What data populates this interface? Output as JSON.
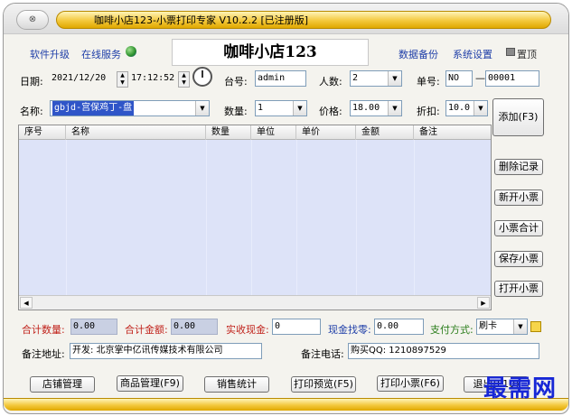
{
  "window": {
    "title": "咖啡小店123-小票打印专家 V10.2.2 [已注册版]",
    "sys_button": "⊗"
  },
  "top_links": {
    "upgrade": "软件升级",
    "online": "在线服务",
    "backup": "数据备份",
    "settings": "系统设置",
    "top": "置顶"
  },
  "shop_name": "咖啡小店123",
  "row1": {
    "date_label": "日期:",
    "date_value": "2021/12/20",
    "time_value": "17:12:52",
    "table_label": "台号:",
    "table_value": "admin",
    "people_label": "人数:",
    "people_value": "2",
    "order_label": "单号:",
    "order_prefix": "NO",
    "order_sep": "—",
    "order_value": "00001"
  },
  "row2": {
    "name_label": "名称:",
    "name_value": "gbjd-宫保鸡丁-盘",
    "qty_label": "数量:",
    "qty_value": "1",
    "price_label": "价格:",
    "price_value": "18.00",
    "discount_label": "折扣:",
    "discount_value": "10.0"
  },
  "table": {
    "columns": [
      "序号",
      "名称",
      "数量",
      "单位",
      "单价",
      "金额",
      "备注"
    ],
    "rows": []
  },
  "side_buttons": {
    "add": "添加(F3)",
    "delete": "删除记录",
    "new": "新开小票",
    "total": "小票合计",
    "save": "保存小票",
    "open": "打开小票"
  },
  "summary": {
    "qty_label": "合计数量:",
    "qty_value": "0.00",
    "amount_label": "合计金额:",
    "amount_value": "0.00",
    "cash_label": "实收现金:",
    "cash_value": "0",
    "change_label": "现金找零:",
    "change_value": "0.00",
    "pay_label": "支付方式:",
    "pay_value": "刷卡"
  },
  "notes": {
    "address_label": "备注地址:",
    "address_value": "开发: 北京掌中亿讯传媒技术有限公司",
    "phone_label": "备注电话:",
    "phone_value": "购买QQ: 1210897529"
  },
  "bottom_buttons": {
    "store": "店铺管理",
    "goods": "商品管理(F9)",
    "sales": "销售统计",
    "preview": "打印预览(F5)",
    "print": "打印小票(F6)",
    "exit": "退出(F10)"
  },
  "watermark": "最需网",
  "colors": {
    "title_gold": "#f3c83c",
    "grid_bg": "#dde3f8",
    "summary_red": "#c0221b",
    "link_blue": "#1f3fa8",
    "watermark_blue": "#1727d6"
  }
}
